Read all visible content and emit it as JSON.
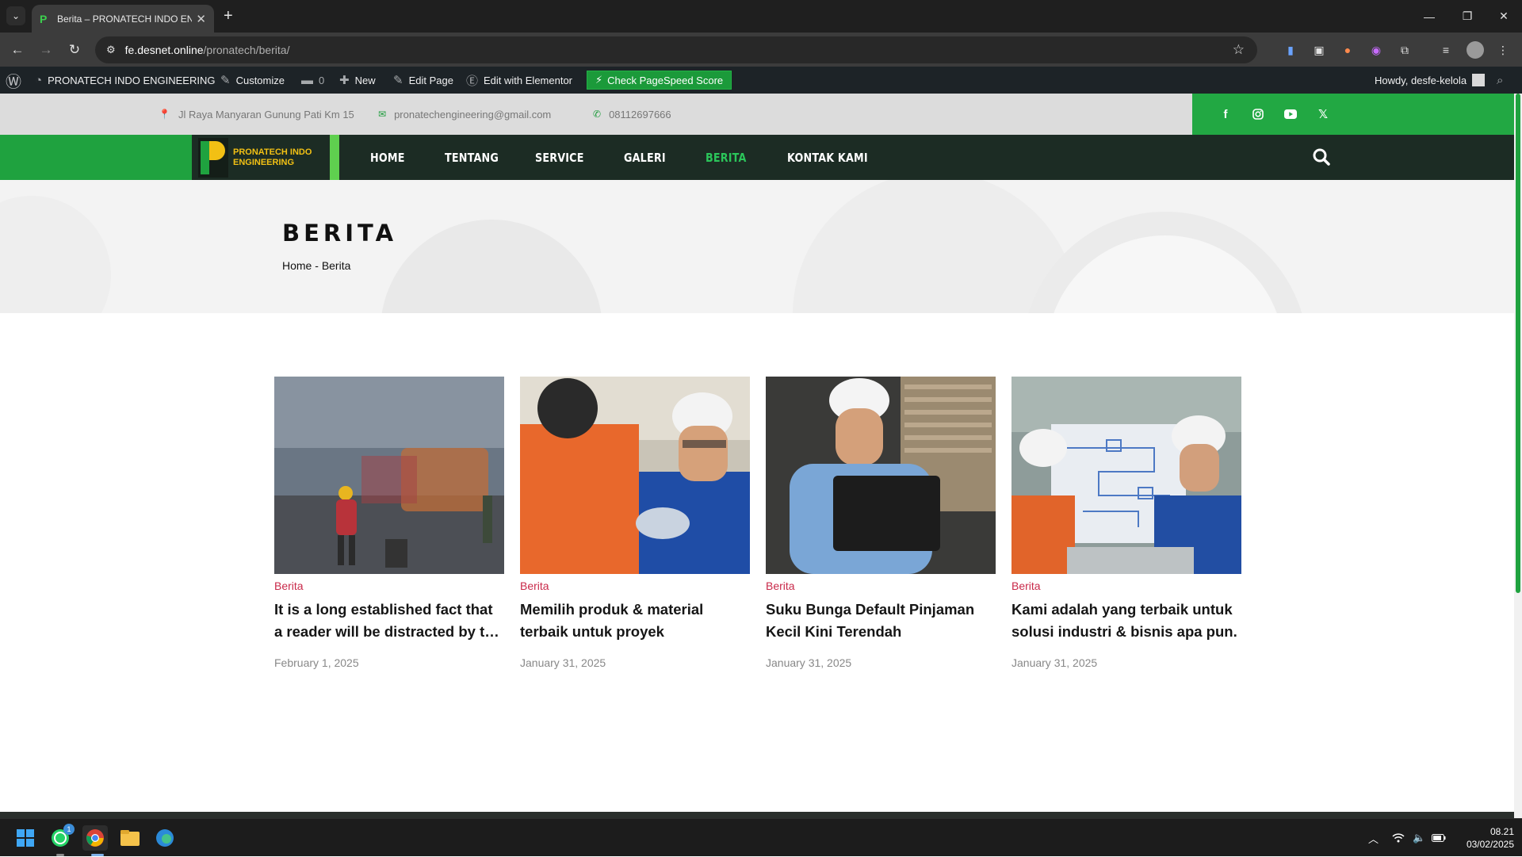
{
  "browser": {
    "tab_title": "Berita – PRONATECH INDO ENGINEERING",
    "url_host": "fe.desnet.online",
    "url_path": "/pronatech/berita/"
  },
  "wp_admin": {
    "site_name": "PRONATECH INDO ENGINEERING",
    "customize": "Customize",
    "comments_count": "0",
    "new": "New",
    "edit_page": "Edit Page",
    "edit_elementor": "Edit with Elementor",
    "pagespeed": "Check PageSpeed Score",
    "howdy": "Howdy, desfe-kelola"
  },
  "topinfo": {
    "address": "Jl Raya Manyaran Gunung Pati Km 15",
    "email": "pronatechengineering@gmail.com",
    "phone": "08112697666"
  },
  "logo": {
    "line1": "PRONATECH INDO",
    "line2": "ENGINEERING"
  },
  "nav": [
    "HOME",
    "TENTANG",
    "SERVICE",
    "GALERI",
    "BERITA",
    "KONTAK KAMI"
  ],
  "hero": {
    "title": "BERITA",
    "crumb_home": "Home",
    "crumb_sep": "-",
    "crumb_current": "Berita"
  },
  "posts": [
    {
      "category": "Berita",
      "title": "It is a long established fact that a reader will be distracted by the readable content",
      "date": "February 1, 2025"
    },
    {
      "category": "Berita",
      "title": "Memilih produk & material terbaik untuk proyek",
      "date": "January 31, 2025"
    },
    {
      "category": "Berita",
      "title": "Suku Bunga Default Pinjaman Kecil Kini Terendah",
      "date": "January 31, 2025"
    },
    {
      "category": "Berita",
      "title": "Kami adalah yang terbaik untuk solusi industri & bisnis apa pun.",
      "date": "January 31, 2025"
    }
  ],
  "taskbar": {
    "time": "08.21",
    "date": "03/02/2025",
    "whatsapp_badge": "1"
  },
  "colors": {
    "brand_green": "#1fa23f",
    "nav_dark": "#1c2c24",
    "accent_yellow": "#f2c014",
    "category_red": "#c92a4a",
    "active_nav": "#2bc55a"
  }
}
